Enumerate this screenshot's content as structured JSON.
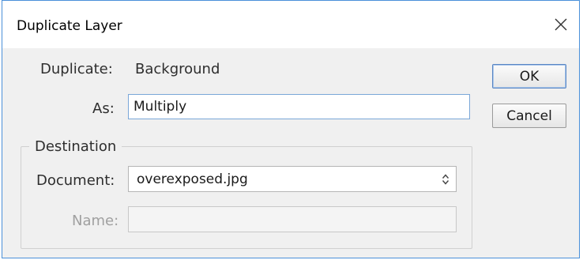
{
  "window": {
    "title": "Duplicate Layer",
    "close_icon": "close-icon"
  },
  "duplicate": {
    "label": "Duplicate:",
    "value": "Background"
  },
  "as": {
    "label": "As:",
    "value": "Multiply"
  },
  "buttons": {
    "ok_label": "OK",
    "cancel_label": "Cancel"
  },
  "destination": {
    "legend": "Destination",
    "document_label": "Document:",
    "document_value": "overexposed.jpg",
    "document_icon": "updown-arrows-icon",
    "name_label": "Name:",
    "name_value": ""
  },
  "colors": {
    "window_border": "#4a90d9",
    "focus_border": "#7aa7d8",
    "dialog_bg": "#f0f0f0"
  }
}
